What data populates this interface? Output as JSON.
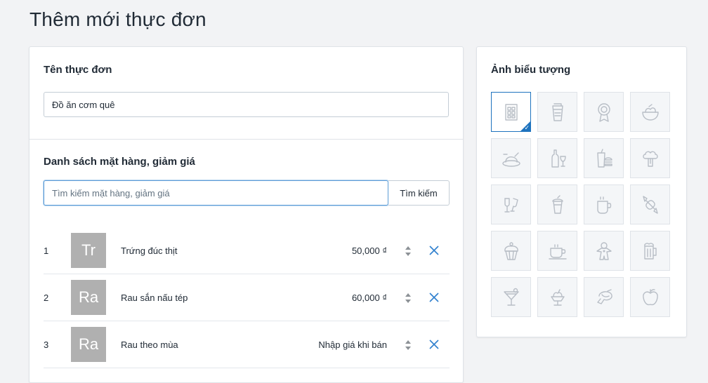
{
  "page": {
    "title": "Thêm mới thực đơn"
  },
  "menu_form": {
    "name_label": "Tên thực đơn",
    "name_value": "Đồ ăn cơm quê",
    "items_label": "Danh sách mặt hàng, giảm giá",
    "search_placeholder": "Tìm kiếm mặt hàng, giảm giá",
    "search_button": "Tìm kiếm",
    "items": [
      {
        "index": "1",
        "thumb": "Tr",
        "name": "Trứng đúc thịt",
        "price": "50,000 ₫"
      },
      {
        "index": "2",
        "thumb": "Ra",
        "name": "Rau sắn nấu tép",
        "price": "60,000 ₫"
      },
      {
        "index": "3",
        "thumb": "Ra",
        "name": "Rau theo mùa",
        "price": "Nhập giá khi bán"
      }
    ]
  },
  "icon_picker": {
    "label": "Ảnh biểu tượng",
    "selected": "menu-board",
    "icons": [
      "menu-board",
      "drink-cup",
      "medal",
      "salad-bowl",
      "roast-dish",
      "wine-bottle-glass",
      "soda-burger",
      "broccoli",
      "toast-glasses",
      "smoothie",
      "coffee-mug",
      "candy",
      "cupcake",
      "tea-cup",
      "gingerbread",
      "beer-mug",
      "cocktail",
      "ice-cream-sundae",
      "shrimp",
      "apple"
    ]
  },
  "colors": {
    "accent": "#1e73be",
    "thumb_bg": "#b0b0b0",
    "icon_stroke": "#b8bec6"
  }
}
